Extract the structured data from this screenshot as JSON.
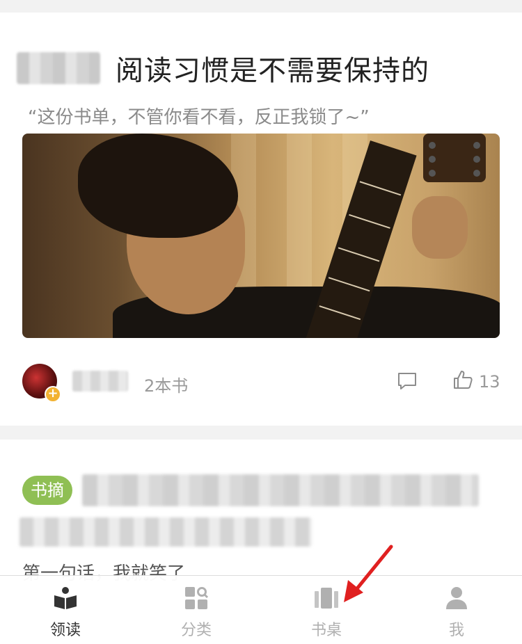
{
  "card1": {
    "title": "阅读习惯是不需要保持的",
    "subtitle": "“这份书单，不管你看不看，反正我锁了~”",
    "book_count": "2本书",
    "like_count": "13"
  },
  "card2": {
    "tag": "书摘",
    "excerpt": "第一句话，我就笑了"
  },
  "tabbar": {
    "items": [
      {
        "label": "领读",
        "icon": "book-open-icon",
        "active": true
      },
      {
        "label": "分类",
        "icon": "category-grid-icon",
        "active": false
      },
      {
        "label": "书桌",
        "icon": "bookshelf-icon",
        "active": false
      },
      {
        "label": "我",
        "icon": "profile-icon",
        "active": false
      }
    ]
  },
  "colors": {
    "tag_green": "#8fbf54",
    "avatar_badge": "#f2b232",
    "annotation_arrow": "#e02020"
  }
}
